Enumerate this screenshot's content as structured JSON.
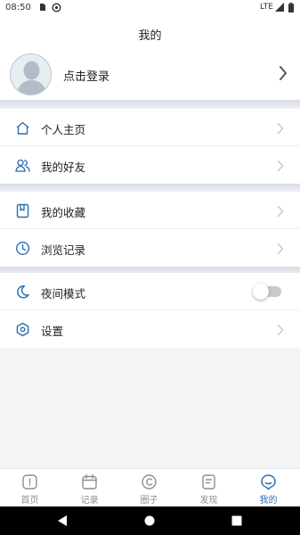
{
  "status": {
    "time": "08:50",
    "network": "LTE"
  },
  "header": {
    "title": "我的"
  },
  "profile": {
    "login_label": "点击登录"
  },
  "sections": [
    {
      "items": [
        {
          "label": "个人主页",
          "icon": "home-icon"
        },
        {
          "label": "我的好友",
          "icon": "friends-icon"
        }
      ]
    },
    {
      "items": [
        {
          "label": "我的收藏",
          "icon": "bookmark-icon"
        },
        {
          "label": "浏览记录",
          "icon": "clock-icon"
        }
      ]
    },
    {
      "items": [
        {
          "label": "夜间模式",
          "icon": "moon-icon",
          "toggle": false
        },
        {
          "label": "设置",
          "icon": "settings-icon"
        }
      ]
    }
  ],
  "tabs": [
    {
      "label": "首页",
      "icon": "home-tab-icon",
      "active": false
    },
    {
      "label": "记录",
      "icon": "calendar-icon",
      "active": false
    },
    {
      "label": "圈子",
      "icon": "circle-icon",
      "active": false
    },
    {
      "label": "发现",
      "icon": "document-icon",
      "active": false
    },
    {
      "label": "我的",
      "icon": "profile-tab-icon",
      "active": true
    }
  ],
  "colors": {
    "accent": "#2f6fb8",
    "icon_blue": "#2b6cb0",
    "background": "#f3f4f6"
  }
}
